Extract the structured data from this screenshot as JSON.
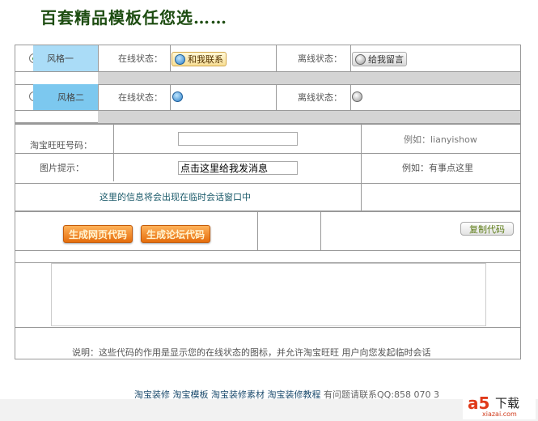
{
  "title": "百套精品模板任您选……",
  "styles": [
    {
      "name": "风格一",
      "online_label": "在线状态：",
      "online_button": "和我联系",
      "offline_label": "离线状态：",
      "offline_button": "给我留言",
      "selected": true
    },
    {
      "name": "风格二",
      "online_label": "在线状态：",
      "offline_label": "离线状态：",
      "selected": false
    }
  ],
  "form": {
    "wangwang_label": "淘宝旺旺号码：",
    "wangwang_value": "",
    "wangwang_example": "例如：lianyishow",
    "tip_label": "图片提示：",
    "tip_value": "点击这里给我发消息",
    "tip_example": "例如：有事点这里",
    "info": "这里的信息将会出现在临时会话窗口中"
  },
  "buttons": {
    "gen_web": "生成网页代码",
    "gen_forum": "生成论坛代码",
    "copy": "复制代码"
  },
  "code_output": "",
  "description": "说明：这些代码的作用是显示您的在线状态的图标，并允许淘宝旺旺 用户向您发起临时会话",
  "footer": {
    "links": [
      "淘宝装修",
      "淘宝模板",
      "淘宝装修素材",
      "淘宝装修教程"
    ],
    "contact": "有问题请联系QQ:858 070 3"
  },
  "watermark": {
    "logo": "a5",
    "text": "下载",
    "site": "xiazai.com"
  }
}
